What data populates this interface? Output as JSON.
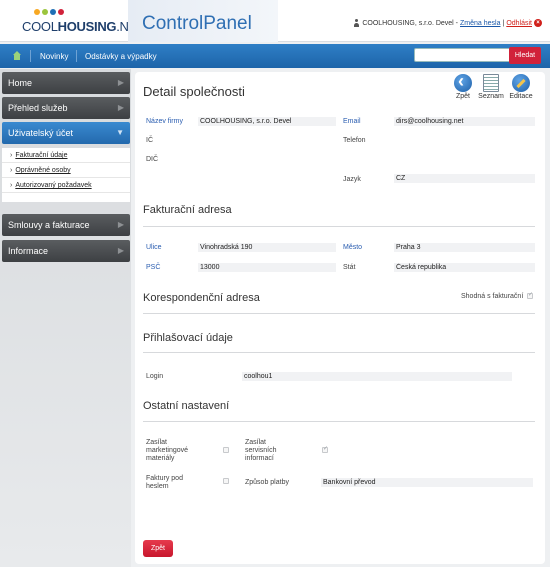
{
  "header": {
    "logo_text_light": "COOL",
    "logo_text_bold": "HOUSING",
    "logo_text_suffix": ".NET",
    "app_title": "ControlPanel",
    "user_name": "COOLHOUSING, s.r.o. Devel -",
    "change_password": "Změna hesla",
    "separator": "|",
    "logout": "Odhlásit",
    "logo_colors": [
      "#f7a823",
      "#9bc53d",
      "#1f6fb5",
      "#d1223a"
    ]
  },
  "nav": {
    "items": [
      "Novinky",
      "Odstávky a výpadky"
    ],
    "search_placeholder": "",
    "search_button": "Hledat"
  },
  "sidebar": {
    "items": [
      "Home",
      "Přehled služeb",
      "Uživatelský účet",
      "Smlouvy a fakturace",
      "Informace"
    ],
    "subitems": [
      "Fakturační údaje",
      "Oprávněné osoby",
      "Autorizovaný požadavek"
    ]
  },
  "page": {
    "title": "Detail společnosti",
    "toolbar": {
      "back": "Zpět",
      "list": "Seznam",
      "edit": "Editace"
    },
    "company": {
      "name_label": "Název firmy",
      "name_value": "COOLHOUSING, s.r.o. Devel",
      "email_label": "Email",
      "email_value": "dirs@coolhousing.net",
      "ic_label": "IČ",
      "phone_label": "Telefon",
      "dic_label": "DIČ",
      "lang_label": "Jazyk",
      "lang_value": "CZ"
    },
    "billing": {
      "heading": "Fakturační adresa",
      "street_label": "Ulice",
      "street_value": "Vinohradská 190",
      "city_label": "Město",
      "city_value": "Praha 3",
      "zip_label": "PSČ",
      "zip_value": "13000",
      "country_label": "Stát",
      "country_value": "Česká republika"
    },
    "correspondence": {
      "heading": "Korespondenční adresa",
      "same_label": "Shodná s fakturační",
      "same_checked": true
    },
    "login": {
      "heading": "Přihlašovací údaje",
      "login_label": "Login",
      "login_value": "coolhou1"
    },
    "other": {
      "heading": "Ostatní nastavení",
      "marketing_label_1": "Zasílat",
      "marketing_label_2": "marketingové",
      "marketing_label_3": "materiály",
      "marketing_checked": false,
      "service_label_1": "Zasílat",
      "service_label_2": "servisních",
      "service_label_3": "informací",
      "service_checked": true,
      "invoice_label_1": "Faktury pod",
      "invoice_label_2": "heslem",
      "invoice_checked": false,
      "payment_label": "Způsob platby",
      "payment_value": "Bankovní převod"
    },
    "back_button": "Zpět"
  }
}
